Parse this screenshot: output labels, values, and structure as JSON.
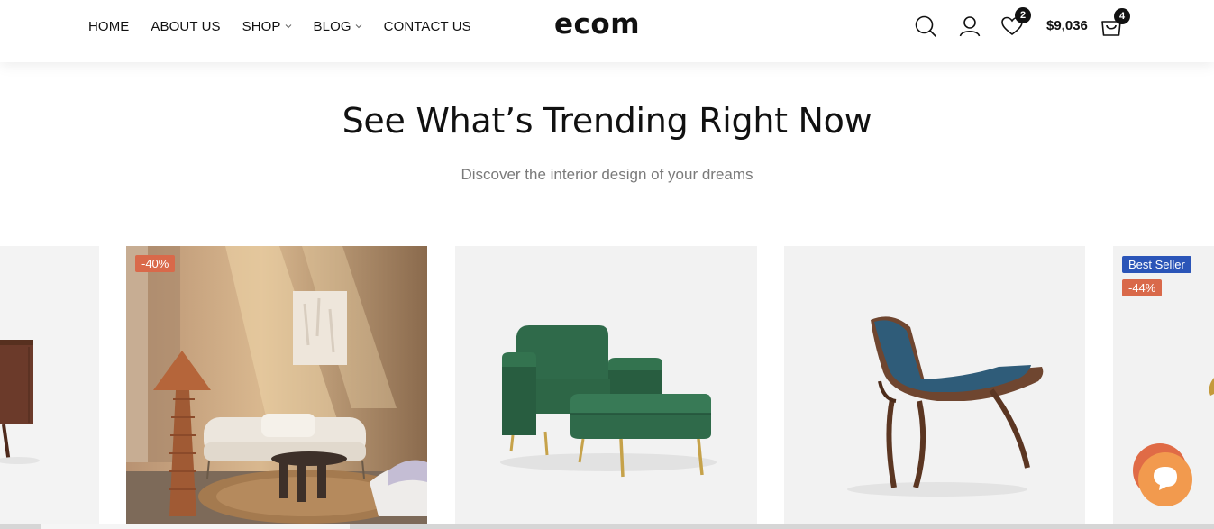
{
  "header": {
    "nav": [
      {
        "label": "HOME",
        "has_dropdown": false
      },
      {
        "label": "ABOUT US",
        "has_dropdown": false
      },
      {
        "label": "SHOP",
        "has_dropdown": true
      },
      {
        "label": "BLOG",
        "has_dropdown": true
      },
      {
        "label": "CONTACT US",
        "has_dropdown": false
      }
    ],
    "logo": "ecom",
    "wishlist_count": "2",
    "cart_total": "$9,036",
    "cart_count": "4"
  },
  "section": {
    "title": "See What’s Trending Right Now",
    "subtitle": "Discover the interior design of your dreams"
  },
  "products": [
    {
      "name": "partial-cabinet",
      "badges": []
    },
    {
      "name": "living-room-scene",
      "badges": [
        {
          "text": "-40%",
          "type": "sale"
        }
      ]
    },
    {
      "name": "green-armchair-ottoman",
      "badges": []
    },
    {
      "name": "blue-shell-chair",
      "badges": []
    },
    {
      "name": "partial-product",
      "badges": [
        {
          "text": "Best Seller",
          "type": "best"
        },
        {
          "text": "-44%",
          "type": "sale"
        }
      ]
    }
  ],
  "colors": {
    "sale_badge": "#d9694a",
    "best_seller_badge": "#2b55b8",
    "chat_button": "#f08a3c"
  },
  "icons": [
    "search-icon",
    "user-icon",
    "heart-icon",
    "cart-icon",
    "chevron-down-icon",
    "chat-icon"
  ]
}
